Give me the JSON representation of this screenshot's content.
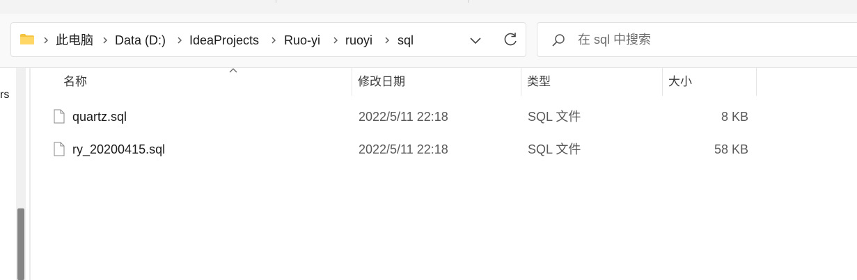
{
  "breadcrumb": {
    "items": [
      "此电脑",
      "Data (D:)",
      "IdeaProjects",
      "Ruo-yi",
      "ruoyi",
      "sql"
    ]
  },
  "search": {
    "placeholder": "在 sql 中搜索"
  },
  "navpane": {
    "partial_text": "rs"
  },
  "columns": {
    "name": "名称",
    "modified": "修改日期",
    "type": "类型",
    "size": "大小"
  },
  "files": [
    {
      "name": "quartz.sql",
      "modified": "2022/5/11 22:18",
      "type": "SQL 文件",
      "size": "8 KB"
    },
    {
      "name": "ry_20200415.sql",
      "modified": "2022/5/11 22:18",
      "type": "SQL 文件",
      "size": "58 KB"
    }
  ],
  "colors": {
    "folder": "#f4c441",
    "scroll_thumb": "#858585"
  },
  "icons": {
    "folder": "folder-icon",
    "chevron": "chevron-right-icon",
    "dropdown": "chevron-down-icon",
    "refresh": "refresh-icon",
    "search": "search-icon",
    "file": "file-icon",
    "sort": "sort-up-icon"
  }
}
